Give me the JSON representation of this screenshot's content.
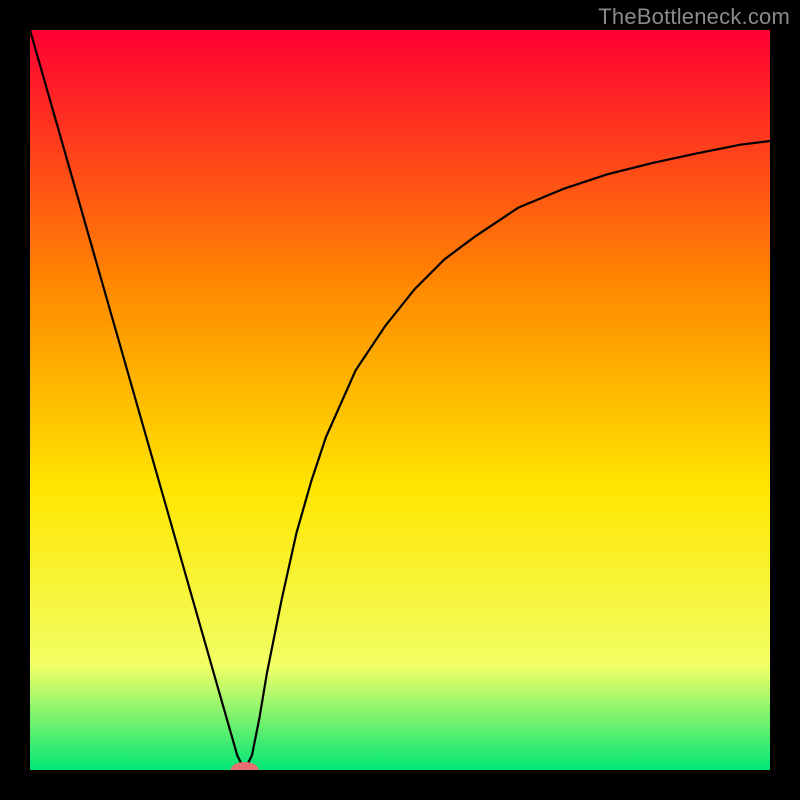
{
  "watermark": "TheBottleneck.com",
  "chart_data": {
    "type": "line",
    "title": "",
    "xlabel": "",
    "ylabel": "",
    "xlim": [
      0,
      100
    ],
    "ylim": [
      0,
      100
    ],
    "x": [
      0,
      2,
      4,
      6,
      8,
      10,
      12,
      14,
      16,
      18,
      20,
      22,
      24,
      26,
      27,
      28,
      29,
      30,
      31,
      32,
      34,
      36,
      38,
      40,
      44,
      48,
      52,
      56,
      60,
      66,
      72,
      78,
      84,
      90,
      96,
      100
    ],
    "y": [
      100,
      93,
      86,
      79,
      72,
      65,
      58,
      51,
      44,
      37,
      30,
      23,
      16,
      9,
      5.5,
      2,
      0,
      2,
      7,
      13,
      23,
      32,
      39,
      45,
      54,
      60,
      65,
      69,
      72,
      76,
      78.5,
      80.5,
      82,
      83.3,
      84.5,
      85
    ],
    "marker_x": 29,
    "marker_y": 0,
    "background_gradient": {
      "top": "#ff0033",
      "upper_mid": "#ff8a00",
      "mid": "#ffe600",
      "lower_mid": "#f2ff66",
      "bottom": "#00e676"
    },
    "line_color": "#000000",
    "marker_color": "#e97070"
  }
}
